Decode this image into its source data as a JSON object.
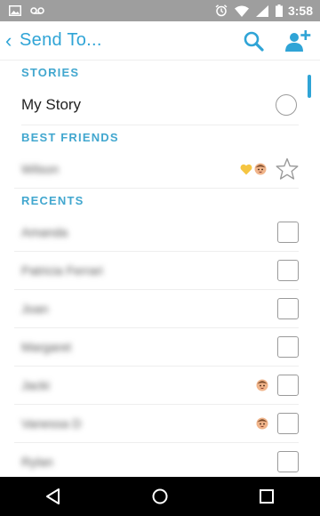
{
  "status_bar": {
    "time": "3:58",
    "icons": [
      "image-icon",
      "voicemail-icon",
      "alarm-icon",
      "wifi-icon",
      "signal-icon",
      "battery-icon"
    ]
  },
  "header": {
    "back_glyph": "‹",
    "title": "Send To...",
    "icons": [
      "search-icon",
      "add-friend-icon"
    ]
  },
  "sections": {
    "stories": {
      "header": "STORIES",
      "items": [
        {
          "name": "My Story"
        }
      ]
    },
    "best_friends": {
      "header": "BEST FRIENDS",
      "items": [
        {
          "name": "Wilson",
          "emojis": [
            "heart",
            "baby"
          ]
        }
      ]
    },
    "recents": {
      "header": "RECENTS",
      "items": [
        {
          "name": "Amanda"
        },
        {
          "name": "Patricia Ferrari"
        },
        {
          "name": "Joan"
        },
        {
          "name": "Margaret"
        },
        {
          "name": "Jacki",
          "emojis": [
            "baby"
          ]
        },
        {
          "name": "Vanessa D",
          "emojis": [
            "baby"
          ]
        },
        {
          "name": "Rylan"
        }
      ]
    }
  },
  "colors": {
    "accent": "#2fa4d6",
    "section_header": "#42a7cf",
    "status_bar": "#9e9e9e",
    "heart": "#f5c542"
  },
  "nav_bar": {
    "icons": [
      "back-icon",
      "home-icon",
      "recents-icon"
    ]
  }
}
